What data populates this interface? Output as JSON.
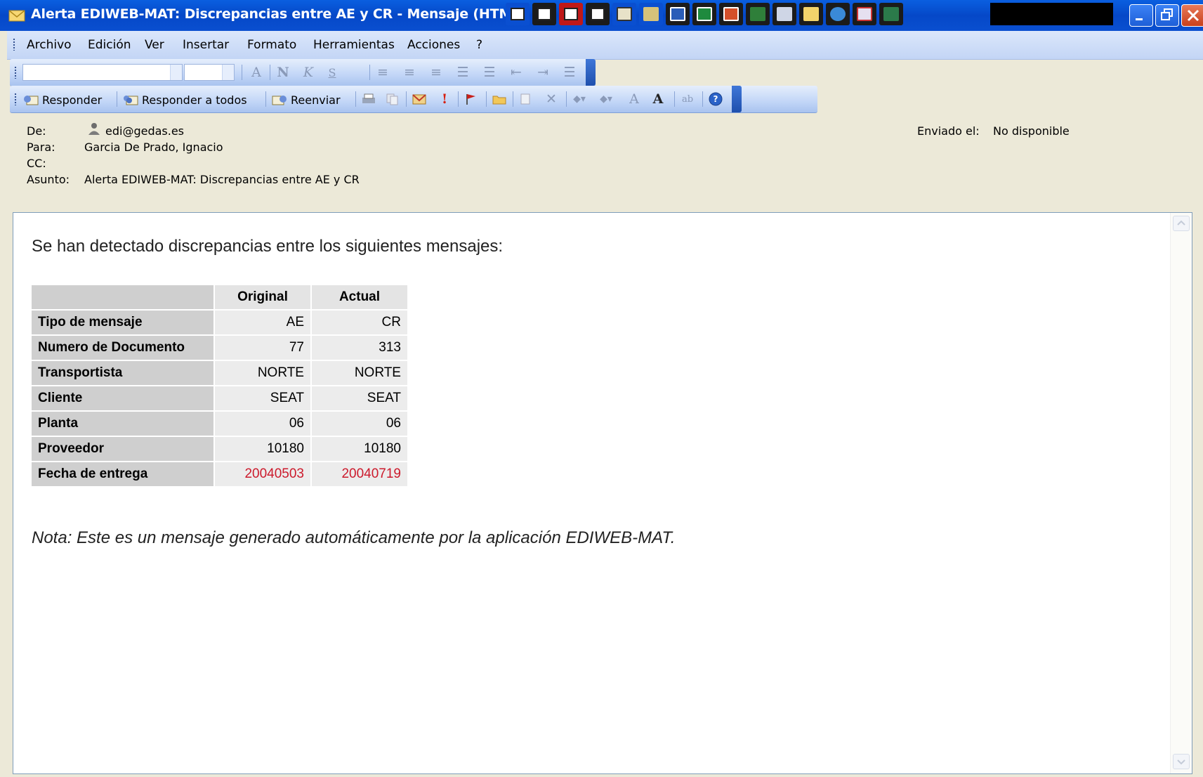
{
  "window": {
    "title": "Alerta EDIWEB-MAT: Discrepancias entre AE y CR - Mensaje (HTML)"
  },
  "menu": [
    {
      "label": "Archivo",
      "name": "menu-archivo"
    },
    {
      "label": "Edición",
      "name": "menu-edicion"
    },
    {
      "label": "Ver",
      "name": "menu-ver"
    },
    {
      "label": "Insertar",
      "name": "menu-insertar"
    },
    {
      "label": "Formato",
      "name": "menu-formato"
    },
    {
      "label": "Herramientas",
      "name": "menu-herramientas"
    },
    {
      "label": "Acciones",
      "name": "menu-acciones"
    },
    {
      "label": "?",
      "name": "menu-ayuda"
    }
  ],
  "toolbar": {
    "reply_label": "Responder",
    "reply_all_label": "Responder a todos",
    "forward_label": "Reenviar"
  },
  "header": {
    "from_label": "De:",
    "from_value": "edi@gedas.es",
    "to_label": "Para:",
    "to_value": "Garcia De Prado, Ignacio",
    "cc_label": "CC:",
    "cc_value": "",
    "subject_label": "Asunto:",
    "subject_value": "Alerta EDIWEB-MAT: Discrepancias entre AE y CR",
    "sent_label": "Enviado el:",
    "sent_value": "No disponible"
  },
  "message": {
    "intro": "Se han detectado discrepancias entre los siguientes mensajes:",
    "table": {
      "columns": [
        "",
        "Original",
        "Actual"
      ],
      "rows": [
        {
          "label": "Tipo de mensaje",
          "original": "AE",
          "actual": "CR",
          "highlight": false
        },
        {
          "label": "Numero de Documento",
          "original": "77",
          "actual": "313",
          "highlight": false
        },
        {
          "label": "Transportista",
          "original": "NORTE",
          "actual": "NORTE",
          "highlight": false
        },
        {
          "label": "Cliente",
          "original": "SEAT",
          "actual": "SEAT",
          "highlight": false
        },
        {
          "label": "Planta",
          "original": "06",
          "actual": "06",
          "highlight": false
        },
        {
          "label": "Proveedor",
          "original": "10180",
          "actual": "10180",
          "highlight": false
        },
        {
          "label": "Fecha de entrega",
          "original": "20040503",
          "actual": "20040719",
          "highlight": true
        }
      ]
    },
    "note": "Nota: Este es un mensaje generado automáticamente por la aplicación EDIWEB-MAT."
  },
  "colors": {
    "titlebar": "#0548c8",
    "highlight_text": "#cc1a2c",
    "header_bg": "#ece9d8"
  }
}
